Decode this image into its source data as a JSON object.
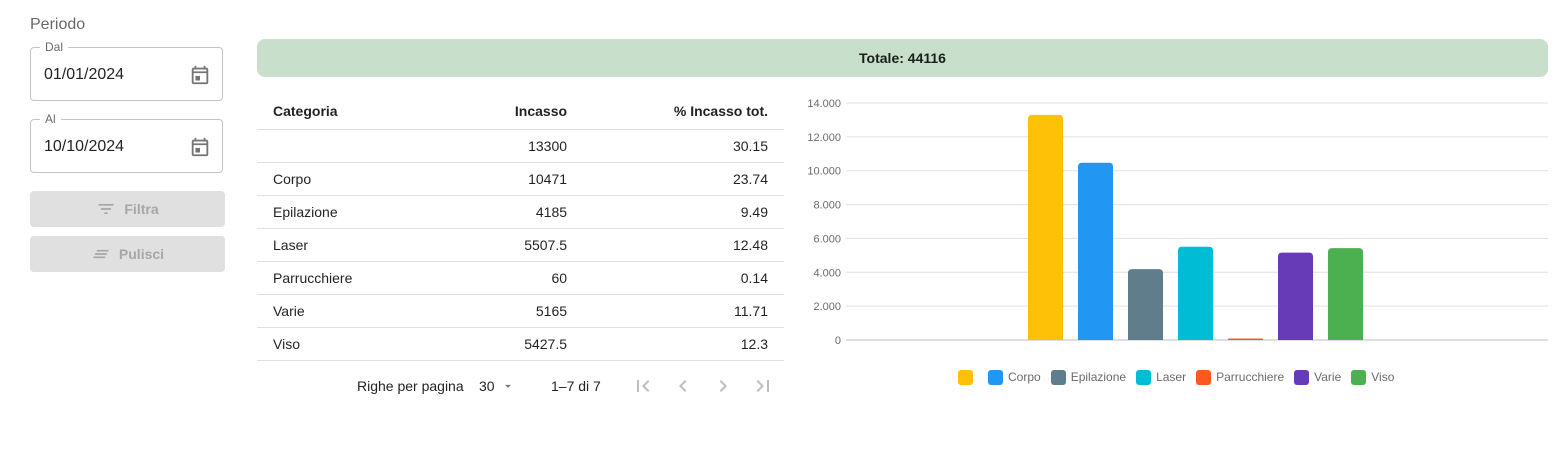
{
  "filters": {
    "section_label": "Periodo",
    "from": {
      "label": "Dal",
      "value": "01/01/2024"
    },
    "to": {
      "label": "Al",
      "value": "10/10/2024"
    },
    "filter_button": "Filtra",
    "clear_button": "Pulisci"
  },
  "total": {
    "text": "Totale: 44116"
  },
  "table": {
    "headers": [
      "Categoria",
      "Incasso",
      "% Incasso tot."
    ],
    "rows": [
      {
        "categoria": "",
        "incasso": "13300",
        "percent": "30.15"
      },
      {
        "categoria": "Corpo",
        "incasso": "10471",
        "percent": "23.74"
      },
      {
        "categoria": "Epilazione",
        "incasso": "4185",
        "percent": "9.49"
      },
      {
        "categoria": "Laser",
        "incasso": "5507.5",
        "percent": "12.48"
      },
      {
        "categoria": "Parrucchiere",
        "incasso": "60",
        "percent": "0.14"
      },
      {
        "categoria": "Varie",
        "incasso": "5165",
        "percent": "11.71"
      },
      {
        "categoria": "Viso",
        "incasso": "5427.5",
        "percent": "12.3"
      }
    ]
  },
  "pagination": {
    "rows_per_page_label": "Righe per pagina",
    "rows_per_page_value": "30",
    "range_text": "1–7 di 7"
  },
  "chart_data": {
    "type": "bar",
    "categories": [
      "",
      "Corpo",
      "Epilazione",
      "Laser",
      "Parrucchiere",
      "Varie",
      "Viso"
    ],
    "values": [
      13300,
      10471,
      4185,
      5507.5,
      60,
      5165,
      5427.5
    ],
    "colors": [
      "#ffc107",
      "#2196f3",
      "#607d8b",
      "#00bcd4",
      "#ff5722",
      "#673ab7",
      "#4caf50"
    ],
    "ylim": [
      0,
      14000
    ],
    "yticks": [
      "0",
      "2.000",
      "4.000",
      "6.000",
      "8.000",
      "10.000",
      "12.000",
      "14.000"
    ],
    "grid": true,
    "legend_position": "bottom"
  }
}
